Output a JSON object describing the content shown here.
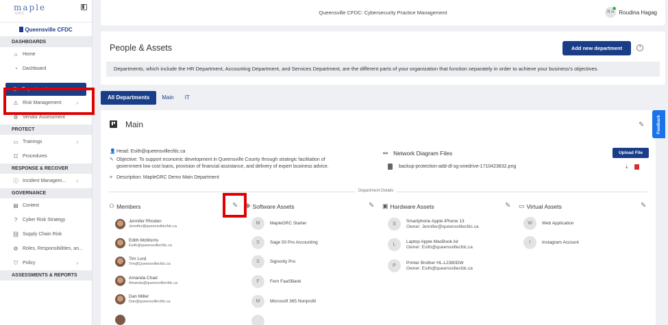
{
  "logo": {
    "name": "maple",
    "sub": "GRC"
  },
  "org": "Queensville CFDC",
  "sidebar": {
    "sections": [
      {
        "title": "DASHBOARDS",
        "items": [
          {
            "label": "Home",
            "icon": "home-icon"
          },
          {
            "label": "Dashboard",
            "icon": "dashboard-icon"
          }
        ]
      },
      {
        "title": "",
        "items": [
          {
            "label": "Departments",
            "icon": "departments-icon",
            "active": true
          },
          {
            "label": "Risk Management",
            "icon": "risk-icon",
            "chevron": true
          },
          {
            "label": "Vendor Assessment",
            "icon": "vendor-icon"
          }
        ]
      },
      {
        "title": "PROTECT",
        "items": [
          {
            "label": "Trainings",
            "icon": "trainings-icon",
            "chevron": true
          },
          {
            "label": "Procedures",
            "icon": "procedures-icon"
          }
        ]
      },
      {
        "title": "RESPONSE & RECOVER",
        "items": [
          {
            "label": "Incident Managem...",
            "icon": "incident-icon",
            "chevron": true
          }
        ]
      },
      {
        "title": "GOVERNANCE",
        "items": [
          {
            "label": "Context",
            "icon": "context-icon"
          },
          {
            "label": "Cyber Risk Strategy",
            "icon": "strategy-icon"
          },
          {
            "label": "Supply Chain Risk",
            "icon": "supply-chain-icon"
          },
          {
            "label": "Roles, Responsibilities, an...",
            "icon": "roles-icon"
          },
          {
            "label": "Policy",
            "icon": "policy-icon",
            "chevron": true
          }
        ]
      },
      {
        "title": "ASSESSMENTS & REPORTS",
        "items": []
      }
    ]
  },
  "topbar": {
    "title": "Queensville CFDC: Cybersecurity Practice Management",
    "user_initials": "R H",
    "user_name": "Roudina Hagag"
  },
  "header": {
    "title": "People & Assets",
    "add_button": "Add new department",
    "help": "?",
    "description": "Departments, which include the HR Department, Accounting Department, and Services Department, are the different parts of your organization that function separately in order to achieve your business's objectives."
  },
  "tabs": [
    "All Departments",
    "Main",
    "IT"
  ],
  "department": {
    "title": "Main",
    "head": "Head: Esith@queensvillecfdc.ca",
    "objective_1": "Objective: To support economic development in Queensville County through strategic facilitation of",
    "objective_2": "government low cost loans, provision of financial assistance, and delivery of expert business advice.",
    "description": "Description: MapleGRC Demo Main Department",
    "network_title": "Network Diagram Files",
    "upload_button": "Upload File",
    "file_name": "backup-protection-add-dl-sg-onedrive-1710423832.png",
    "divider": "Department Details"
  },
  "columns": {
    "members": "Members",
    "software": "Software Assets",
    "hardware": "Hardware Assets",
    "virtual": "Virtual Assets"
  },
  "members": [
    {
      "name": "Jennifer Rhoden",
      "email": "Jennifer@queensvillecfdc.ca"
    },
    {
      "name": "Edith McMorris",
      "email": "Esith@queensvillecfdc.ca"
    },
    {
      "name": "Tim Lord",
      "email": "Tim@Queensvillecfdc.ca"
    },
    {
      "name": "Amanda Chad",
      "email": "Amanda@queensvillecfdc.ca"
    },
    {
      "name": "Dan Miller",
      "email": "Dan@queensvillecfdc.ca"
    }
  ],
  "software": [
    {
      "initial": "M",
      "name": "MapleGRC Starter"
    },
    {
      "initial": "S",
      "name": "Sage 50 Pro Accounting"
    },
    {
      "initial": "S",
      "name": "Signority Pro"
    },
    {
      "initial": "F",
      "name": "Fern FaaSBank"
    },
    {
      "initial": "M",
      "name": "Microsoft 365 Nonprofit"
    }
  ],
  "hardware": [
    {
      "initial": "S",
      "name": "Smartphone Apple iPhone 13",
      "owner": "Owner: Jennifer@queensvillecfdc.ca"
    },
    {
      "initial": "L",
      "name": "Laptop Apple MacBook Air",
      "owner": "Owner: Esith@queensvillecfdc.ca"
    },
    {
      "initial": "P",
      "name": "Printer Brother HL-L2380DW",
      "owner": "Owner: Esith@queensvillecfdc.ca"
    }
  ],
  "virtual": [
    {
      "initial": "W",
      "name": "Web Application"
    },
    {
      "initial": "I",
      "name": "Instagram Account"
    }
  ],
  "feedback": "Feedback"
}
